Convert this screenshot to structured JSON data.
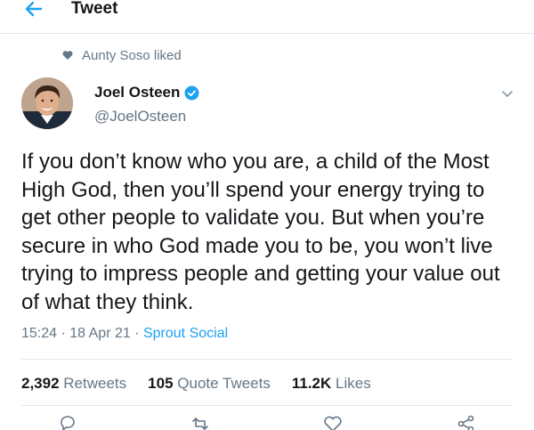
{
  "header": {
    "title": "Tweet"
  },
  "social_context": {
    "text": "Aunty Soso liked"
  },
  "author": {
    "name": "Joel Osteen",
    "handle": "@JoelOsteen"
  },
  "tweet": {
    "text": "If you don’t know who you are, a child of the Most High God, then you’ll spend your energy trying to get other people to validate you. But when you’re secure in who God made you to be, you won’t live trying to impress people and getting your value out of what they think."
  },
  "meta": {
    "time": "15:24",
    "sep1": " · ",
    "date": "18 Apr 21",
    "sep2": " · ",
    "source": "Sprout Social"
  },
  "stats": {
    "retweets_count": "2,392",
    "retweets_label": "Retweets",
    "quotes_count": "105",
    "quotes_label": "Quote Tweets",
    "likes_count": "11.2K",
    "likes_label": "Likes"
  },
  "colors": {
    "accent": "#1da1f2",
    "muted": "#657786",
    "text": "#14171a",
    "border": "#e1e8ed"
  },
  "icons": [
    "back-arrow-icon",
    "heart-icon",
    "verified-badge-icon",
    "chevron-down-icon",
    "reply-icon",
    "retweet-icon",
    "like-icon",
    "share-icon"
  ]
}
